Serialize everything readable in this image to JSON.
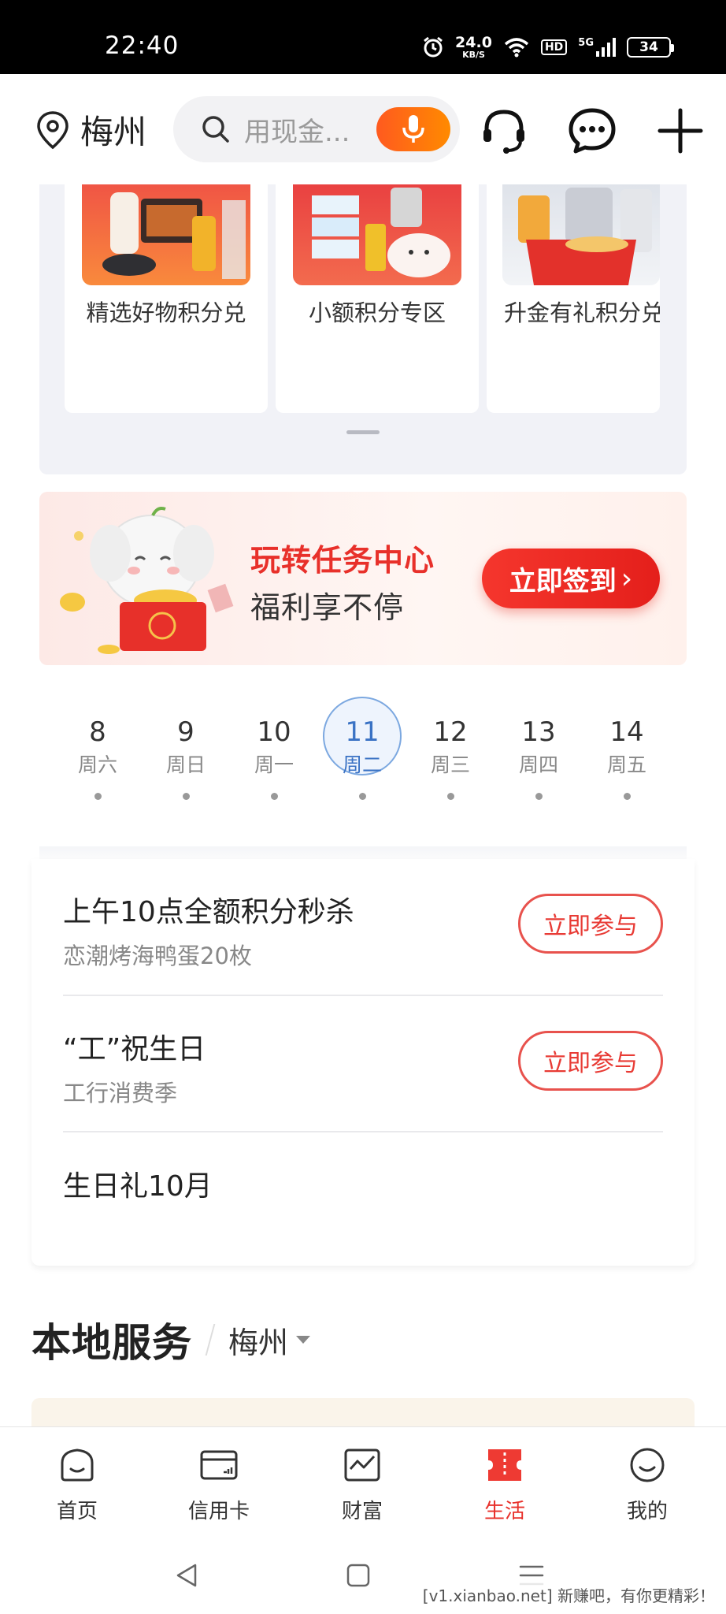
{
  "status_bar": {
    "time": "22:40",
    "net_speed_value": "24.0",
    "net_speed_unit": "KB/S",
    "hd": "HD",
    "signal": "5G",
    "battery": "34"
  },
  "header": {
    "location": "梅州",
    "search_placeholder": "用现金...",
    "icons": [
      "location-pin-icon",
      "search-icon",
      "microphone-icon",
      "customer-service-icon",
      "message-icon",
      "plus-icon"
    ]
  },
  "points_mall": {
    "items": [
      {
        "label": "精选好物积分兑"
      },
      {
        "label": "小额积分专区"
      },
      {
        "label": "升金有礼积分兑"
      }
    ]
  },
  "task_banner": {
    "title": "玩转任务中心",
    "subtitle": "福利享不停",
    "button": "立即签到",
    "button_arrow": "›"
  },
  "dates": [
    {
      "day": "8",
      "weekday": "周六",
      "active": false
    },
    {
      "day": "9",
      "weekday": "周日",
      "active": false
    },
    {
      "day": "10",
      "weekday": "周一",
      "active": false
    },
    {
      "day": "11",
      "weekday": "周二",
      "active": true
    },
    {
      "day": "12",
      "weekday": "周三",
      "active": false
    },
    {
      "day": "13",
      "weekday": "周四",
      "active": false
    },
    {
      "day": "14",
      "weekday": "周五",
      "active": false
    }
  ],
  "activities": [
    {
      "title": "上午10点全额积分秒杀",
      "subtitle": "恋潮烤海鸭蛋20枚",
      "button": "立即参与"
    },
    {
      "title": "“工”祝生日",
      "subtitle": "工行消费季",
      "button": "立即参与"
    },
    {
      "title": "生日礼10月"
    }
  ],
  "local_services": {
    "title": "本地服务",
    "city": "梅州"
  },
  "tab_bar": {
    "tabs": [
      {
        "label": "首页",
        "icon": "home-icon",
        "active": false
      },
      {
        "label": "信用卡",
        "icon": "credit-card-icon",
        "active": false
      },
      {
        "label": "财富",
        "icon": "wealth-chart-icon",
        "active": false
      },
      {
        "label": "生活",
        "icon": "life-ticket-icon",
        "active": true
      },
      {
        "label": "我的",
        "icon": "profile-smile-icon",
        "active": false
      }
    ]
  },
  "colors": {
    "accent_red": "#e8302a",
    "active_date_blue": "#3a72c4",
    "mic_orange": "#ff6a10"
  },
  "watermark": "[v1.xianbao.net] 新赚吧，有你更精彩！"
}
